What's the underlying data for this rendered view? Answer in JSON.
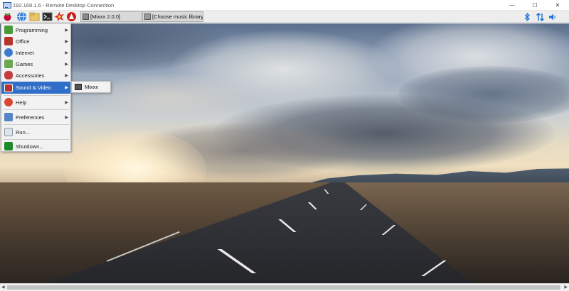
{
  "window": {
    "title": "192.168.1.6 - Remote Desktop Connection",
    "controls": {
      "minimize": "—",
      "maximize": "☐",
      "close": "✕"
    }
  },
  "panel": {
    "launchers": [
      {
        "icon": "raspberry-menu-icon",
        "color": "#c7053d"
      },
      {
        "icon": "web-browser-icon",
        "color": "#3b83d6"
      },
      {
        "icon": "file-manager-icon",
        "color": "#e9c766"
      },
      {
        "icon": "terminal-icon",
        "color": "#2b2b2b"
      },
      {
        "icon": "burst-icon",
        "color": "#d62b2b"
      },
      {
        "icon": "mathematica-icon",
        "color": "#c92020"
      }
    ],
    "tasks": [
      {
        "label": "[Mixxx 2.0.0]"
      },
      {
        "label": "[Choose music library di..."
      }
    ],
    "tray": {
      "bluetooth": "✱",
      "network": "⇅",
      "volume": "🔈"
    }
  },
  "menu": {
    "items": [
      {
        "label": "Programming",
        "icon": "programming-icon",
        "color": "#4a9a3a",
        "submenu": true
      },
      {
        "label": "Office",
        "icon": "office-icon",
        "color": "#b8332b",
        "submenu": true
      },
      {
        "label": "Internet",
        "icon": "internet-icon",
        "color": "#3a7bd0",
        "submenu": true
      },
      {
        "label": "Games",
        "icon": "games-icon",
        "color": "#6aa84f",
        "submenu": true
      },
      {
        "label": "Accessories",
        "icon": "accessories-icon",
        "color": "#c43c3c",
        "submenu": true
      },
      {
        "label": "Sound & Video",
        "icon": "sound-video-icon",
        "color": "#b8322b",
        "submenu": true,
        "active": true
      },
      {
        "label": "Help",
        "icon": "help-icon",
        "color": "#d9452f",
        "submenu": true
      },
      {
        "label": "Preferences",
        "icon": "preferences-icon",
        "color": "#5585c5",
        "submenu": true
      },
      {
        "label": "Run...",
        "icon": "run-icon",
        "color": "#8a9aa8",
        "submenu": false
      },
      {
        "label": "Shutdown...",
        "icon": "shutdown-icon",
        "color": "#1e8a2a",
        "submenu": false
      }
    ],
    "submenu_arrow": "▶"
  },
  "submenu": {
    "items": [
      {
        "label": "Mixxx",
        "icon": "mixxx-icon"
      }
    ]
  },
  "scrollbar": {
    "left_arrow": "◀",
    "right_arrow": "▶"
  }
}
